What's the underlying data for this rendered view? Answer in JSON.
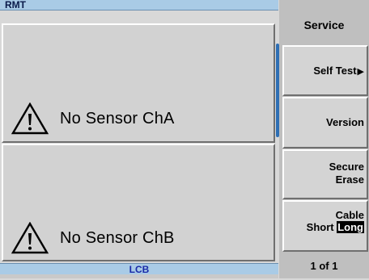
{
  "status": {
    "top_label": "RMT",
    "bottom_label": "LCB"
  },
  "channels": [
    {
      "message": "No Sensor ChA",
      "icon": "warning-icon"
    },
    {
      "message": "No Sensor ChB",
      "icon": "warning-icon"
    }
  ],
  "menu": {
    "title": "Service",
    "keys": {
      "self_test": "Self Test",
      "version": "Version",
      "secure_line1": "Secure",
      "secure_line2": "Erase",
      "cable_line1": "Cable",
      "cable_short": "Short",
      "cable_long": "Long"
    },
    "page": "1 of 1"
  },
  "colors": {
    "status_bar": "#a9cbe6",
    "accent": "#2e6fb4",
    "panel": "#d2d2d2"
  }
}
